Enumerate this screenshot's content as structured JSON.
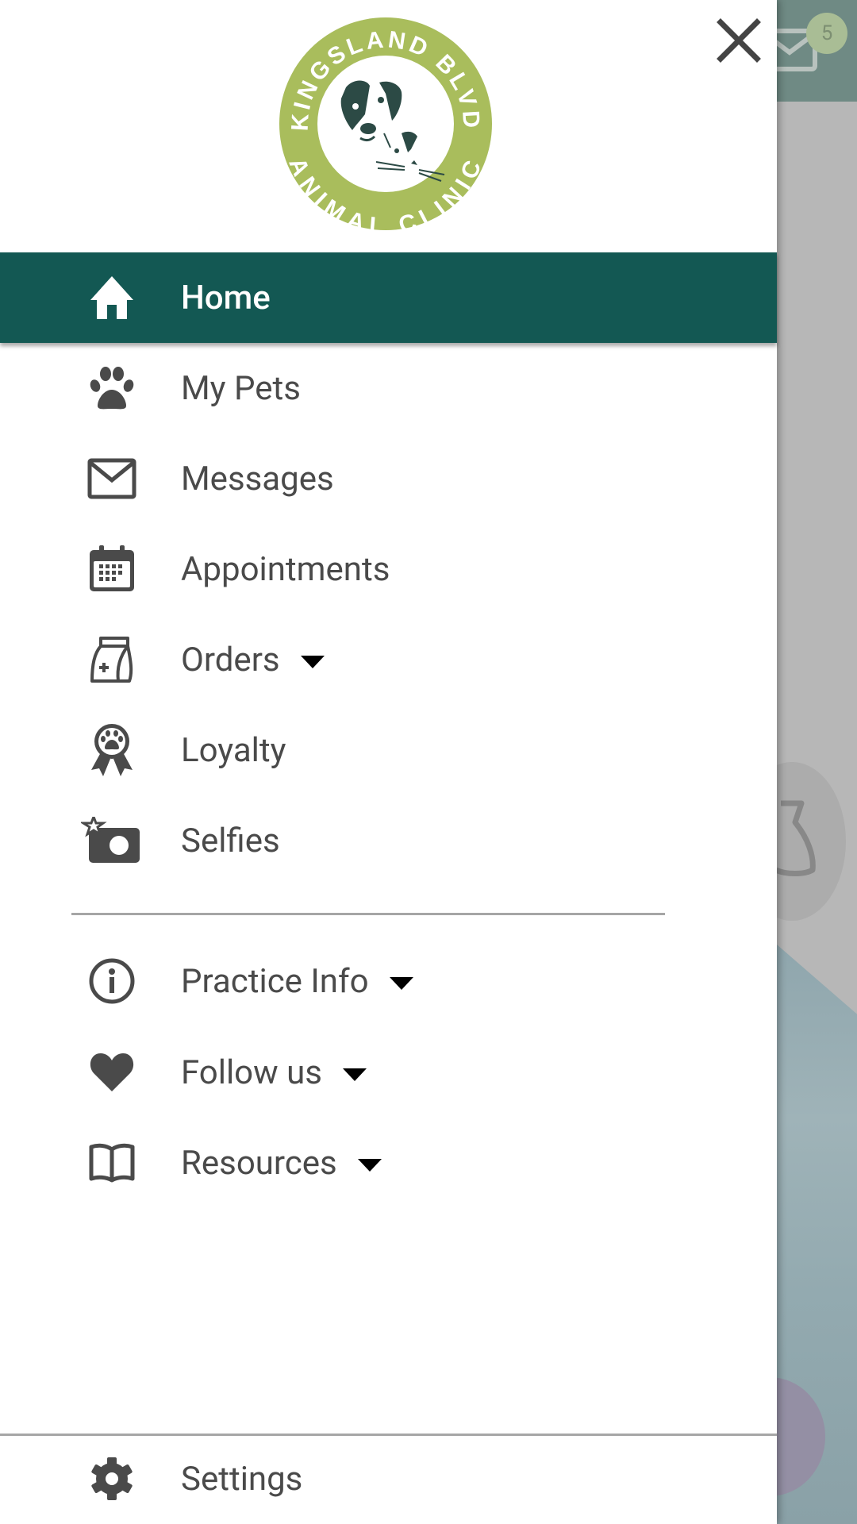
{
  "background": {
    "unread_badge": "5",
    "header_color": "#6f8a84",
    "badge_color": "#a9bd95"
  },
  "drawer": {
    "logo": {
      "top_text": "KINGSLAND BLVD",
      "bottom_text": "ANIMAL CLINIC",
      "ring_color": "#a9bd5c",
      "art_color": "#2c4a45"
    },
    "accent_color": "#135853",
    "menu": [
      {
        "label": "Home",
        "icon": "home-icon",
        "active": true,
        "has_dropdown": false
      },
      {
        "label": "My Pets",
        "icon": "paw-icon",
        "active": false,
        "has_dropdown": false
      },
      {
        "label": "Messages",
        "icon": "envelope-icon",
        "active": false,
        "has_dropdown": false
      },
      {
        "label": "Appointments",
        "icon": "calendar-icon",
        "active": false,
        "has_dropdown": false
      },
      {
        "label": "Orders",
        "icon": "medicine-bag-icon",
        "active": false,
        "has_dropdown": true
      },
      {
        "label": "Loyalty",
        "icon": "award-ribbon-icon",
        "active": false,
        "has_dropdown": false
      },
      {
        "label": "Selfies",
        "icon": "camera-star-icon",
        "active": false,
        "has_dropdown": false
      }
    ],
    "secondary_menu": [
      {
        "label": "Practice Info",
        "icon": "info-icon",
        "has_dropdown": true
      },
      {
        "label": "Follow us",
        "icon": "heart-icon",
        "has_dropdown": true
      },
      {
        "label": "Resources",
        "icon": "book-icon",
        "has_dropdown": true
      }
    ],
    "footer": {
      "label": "Settings",
      "icon": "gear-icon"
    }
  }
}
